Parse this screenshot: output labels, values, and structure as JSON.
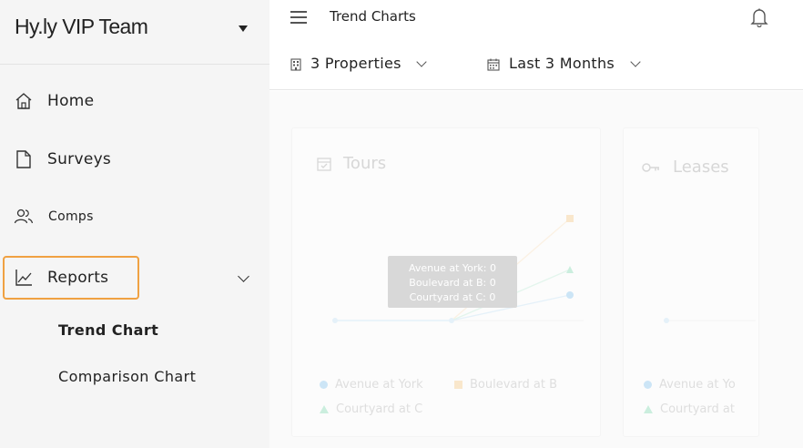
{
  "team": {
    "name": "Hy.ly VIP Team"
  },
  "nav": {
    "home": "Home",
    "surveys": "Surveys",
    "comps": "Comps",
    "reports": "Reports",
    "sub_items": [
      "Trend Chart",
      "Comparison Chart"
    ]
  },
  "header": {
    "title": "Trend Charts"
  },
  "filters": {
    "properties": "3 Properties",
    "date_range": "Last 3 Months"
  },
  "cards": [
    {
      "title": "Tours",
      "legend": [
        "Avenue at York",
        "Boulevard at B",
        "Courtyard at C"
      ]
    },
    {
      "title": "Leases",
      "legend": [
        "Avenue at Yo",
        "Courtyard at"
      ]
    }
  ],
  "tooltip": {
    "lines": [
      "Avenue at York: 0",
      "Boulevard at B: 0",
      "Courtyard at C: 0"
    ]
  },
  "colors": {
    "accent_outline": "#f0a142",
    "series_avenue": "#a8d4f4",
    "series_boulevard": "#f9d9a8",
    "series_courtyard": "#a6e6c8"
  }
}
